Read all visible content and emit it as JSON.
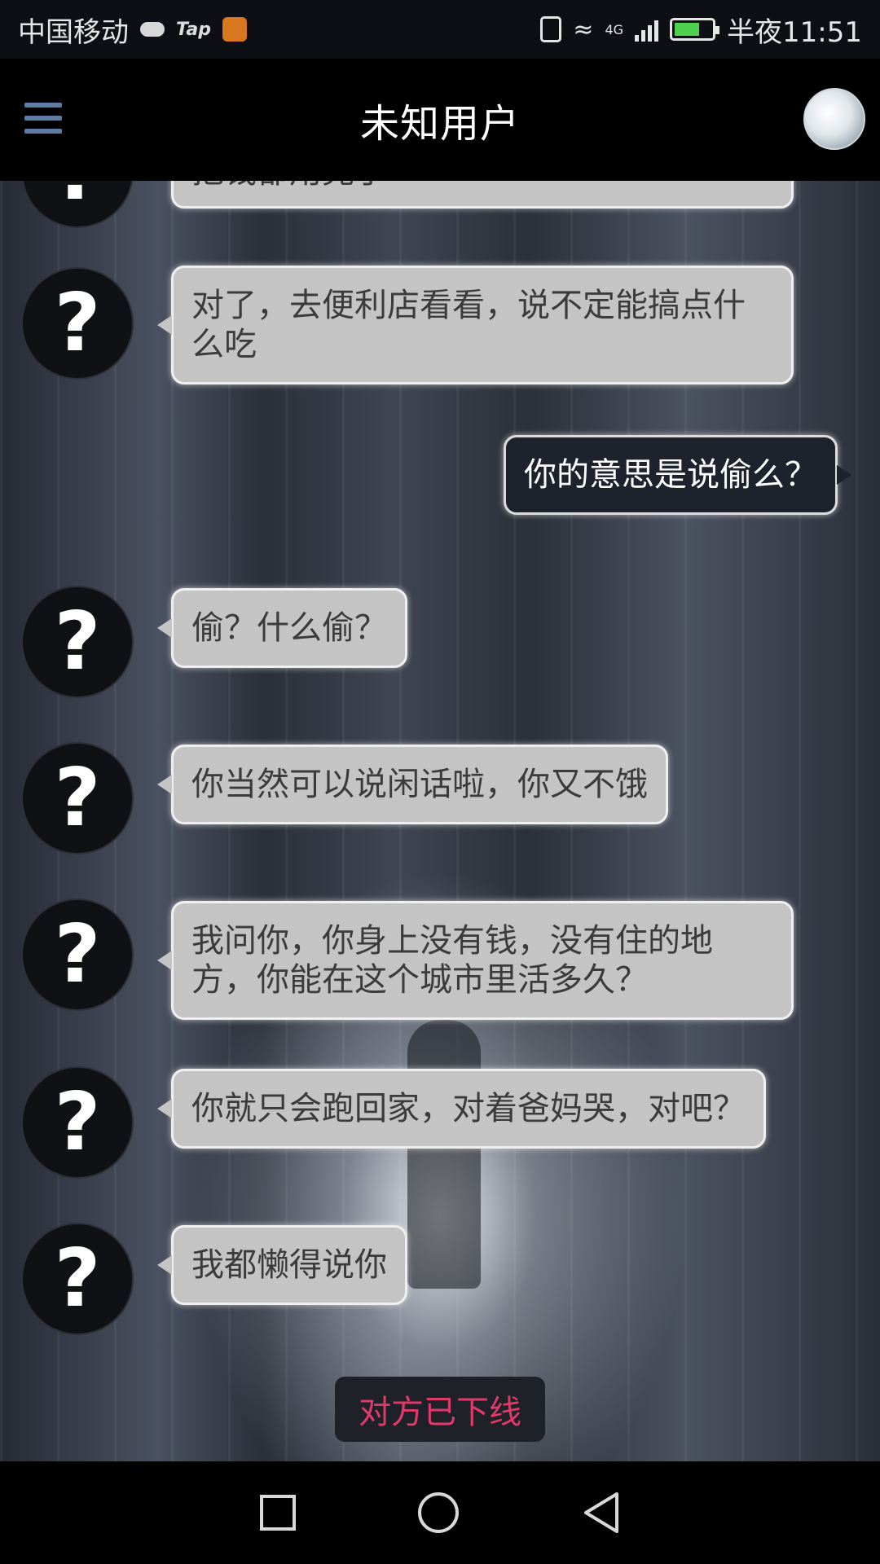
{
  "status_bar": {
    "carrier": "中国移动",
    "tap_label": "Tap",
    "network": "4G",
    "time": "半夜11:51"
  },
  "header": {
    "title": "未知用户"
  },
  "messages": [
    {
      "sender": "other",
      "text": "把钱都用完了"
    },
    {
      "sender": "other",
      "text": "对了，去便利店看看，说不定能搞点什么吃"
    },
    {
      "sender": "me",
      "text": "你的意思是说偷么？"
    },
    {
      "sender": "other",
      "text": "偷？什么偷？"
    },
    {
      "sender": "other",
      "text": "你当然可以说闲话啦，你又不饿"
    },
    {
      "sender": "other",
      "text": "我问你，你身上没有钱，没有住的地方，你能在这个城市里活多久？"
    },
    {
      "sender": "other",
      "text": "你就只会跑回家，对着爸妈哭，对吧？"
    },
    {
      "sender": "other",
      "text": "我都懒得说你"
    }
  ],
  "avatar_symbol": "?",
  "status_notice": "对方已下线",
  "colors": {
    "offline_text": "#e0396a",
    "menu_icon": "#5d7da6",
    "other_bubble": "#c4c4c4",
    "my_bubble": "#1d222d"
  }
}
